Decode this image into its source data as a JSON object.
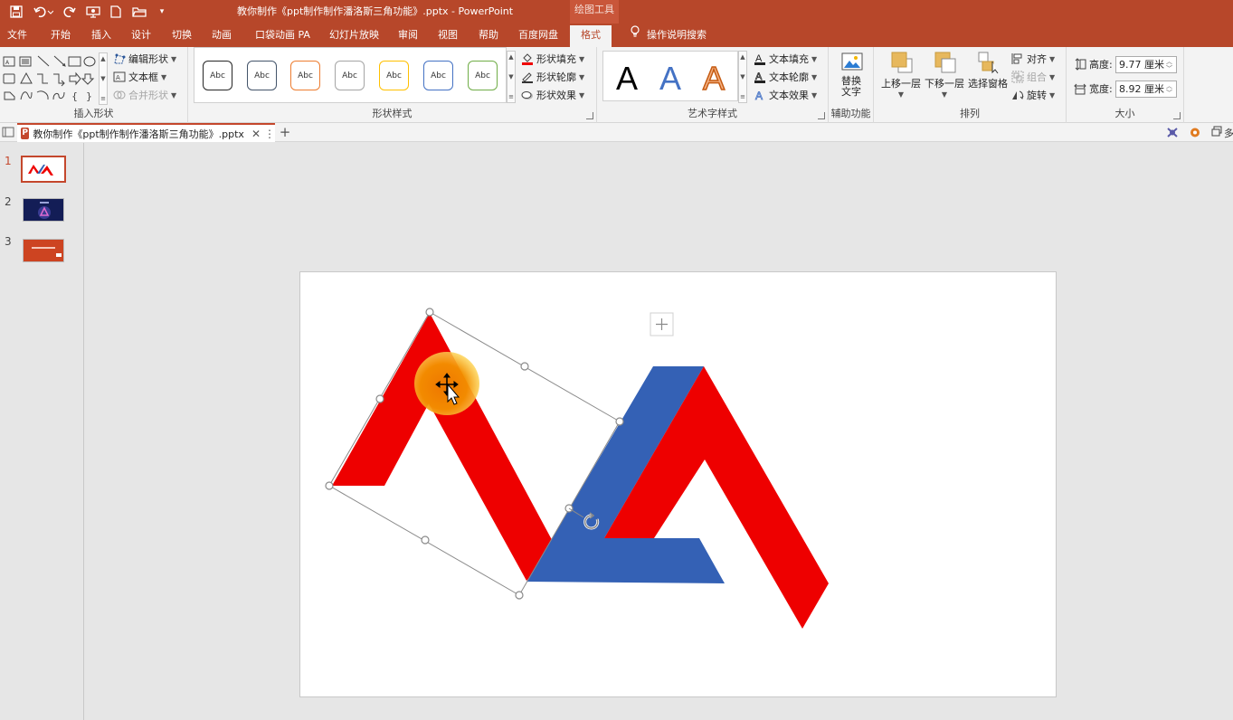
{
  "window": {
    "title": "教你制作《ppt制作制作潘洛斯三角功能》.pptx  -  PowerPoint",
    "contextual_tab_group": "绘图工具"
  },
  "tabs": [
    "文件",
    "开始",
    "插入",
    "设计",
    "切换",
    "动画",
    "口袋动画 PA",
    "幻灯片放映",
    "审阅",
    "视图",
    "帮助",
    "百度网盘",
    "格式"
  ],
  "active_tab": "格式",
  "tell_me": "操作说明搜索",
  "ribbon": {
    "insert_shapes": {
      "label": "插入形状",
      "edit_shape": "编辑形状",
      "text_box": "文本框",
      "merge_shapes": "合并形状"
    },
    "shape_styles": {
      "label": "形状样式",
      "swatch_text": "Abc",
      "swatch_borders": [
        "#262626",
        "#44546a",
        "#ed7d31",
        "#a5a5a5",
        "#ffc000",
        "#4472c4",
        "#70ad47"
      ],
      "fill": "形状填充",
      "outline": "形状轮廓",
      "effects": "形状效果"
    },
    "wordart_styles": {
      "label": "艺术字样式",
      "sample": "A",
      "text_fill": "文本填充",
      "text_outline": "文本轮廓",
      "text_effects": "文本效果"
    },
    "accessibility": {
      "label": "辅助功能",
      "alt_text": "替换\n文字"
    },
    "arrange": {
      "label": "排列",
      "bring_forward": "上移一层",
      "send_backward": "下移一层",
      "selection_pane": "选择窗格",
      "align": "对齐",
      "group": "组合",
      "rotate": "旋转"
    },
    "size": {
      "label": "大小",
      "height_label": "高度:",
      "height_value": "9.77 厘米",
      "width_label": "宽度:",
      "width_value": "8.92 厘米"
    }
  },
  "document_tab": {
    "name": "教你制作《ppt制作制作潘洛斯三角功能》.pptx",
    "app_badge": "P"
  },
  "right_strip_text": "多",
  "slides": [
    {
      "number": "1",
      "selected": true
    },
    {
      "number": "2",
      "selected": false
    },
    {
      "number": "3",
      "selected": false
    }
  ],
  "colors": {
    "brand": "#b7472a",
    "red_shape": "#ee0000",
    "blue_shape": "#3461b5",
    "highlight": "#f08c00"
  }
}
